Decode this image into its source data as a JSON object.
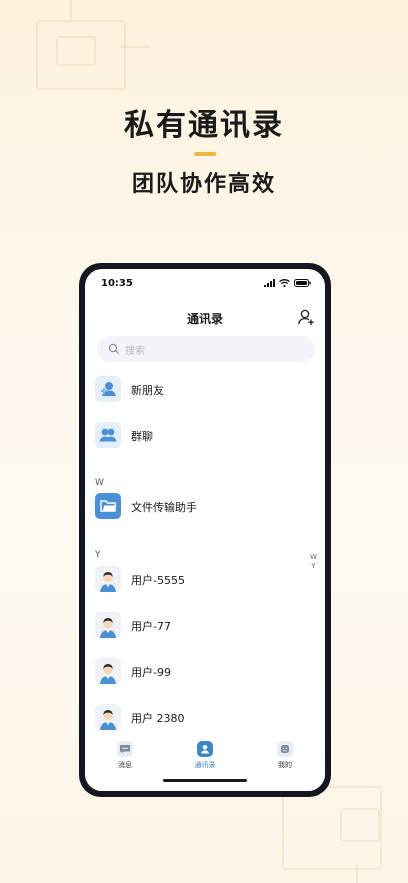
{
  "promo": {
    "headline": "私有通讯录",
    "subhead": "团队协作高效"
  },
  "status": {
    "time": "10:35"
  },
  "header": {
    "title": "通讯录"
  },
  "search": {
    "placeholder": "搜索"
  },
  "quick_items": [
    {
      "label": "新朋友",
      "icon": "new-friend-icon"
    },
    {
      "label": "群聊",
      "icon": "group-chat-icon"
    }
  ],
  "sections": [
    {
      "letter": "W",
      "items": [
        {
          "label": "文件传输助手",
          "icon": "folder-icon"
        }
      ]
    },
    {
      "letter": "Y",
      "items": [
        {
          "label": "用户-5555",
          "icon": "user-avatar"
        },
        {
          "label": "用户-77",
          "icon": "user-avatar"
        },
        {
          "label": "用户-99",
          "icon": "user-avatar"
        },
        {
          "label": "用户 2380",
          "icon": "user-avatar"
        }
      ]
    }
  ],
  "index": [
    "W",
    "Y"
  ],
  "tabs": [
    {
      "label": "消息",
      "icon": "message-icon",
      "active": false
    },
    {
      "label": "通讯录",
      "icon": "contacts-icon",
      "active": true
    },
    {
      "label": "我的",
      "icon": "profile-icon",
      "active": false
    }
  ],
  "colors": {
    "accent": "#f2b441",
    "brand_blue": "#4a90d6",
    "active_tab": "#3a86c8"
  }
}
